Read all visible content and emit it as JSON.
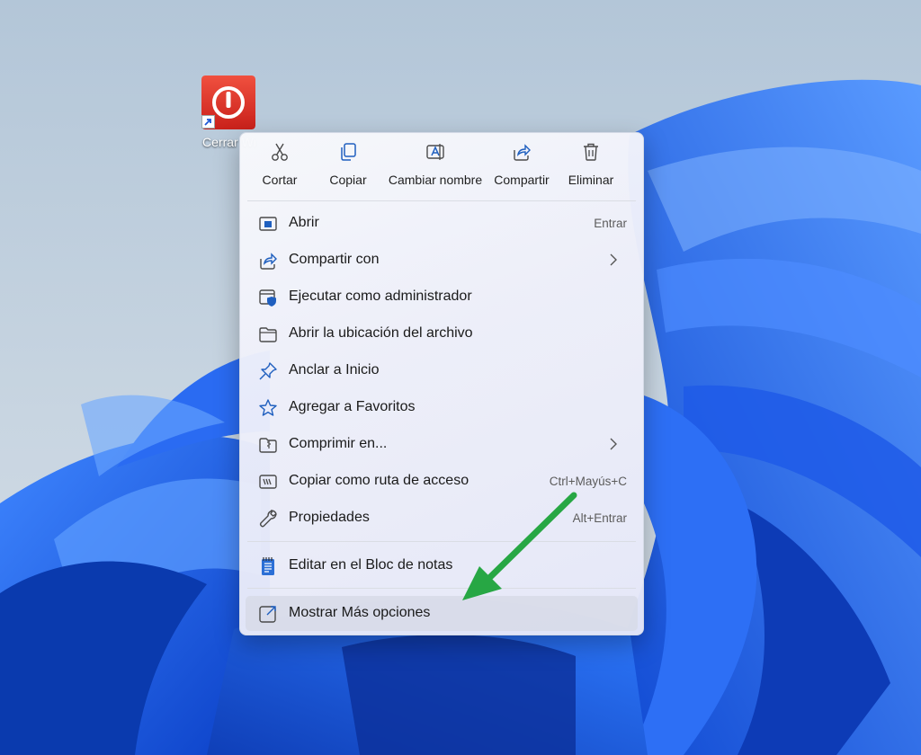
{
  "colors": {
    "accent": "#0067c0",
    "arrow": "#27a744",
    "wallpaper_blue": "#1e5fe6",
    "icon_red": "#e0312a"
  },
  "desktop_icon": {
    "label": "Cerrar Wi",
    "icon": "power-icon"
  },
  "context_menu": {
    "quick_actions": [
      {
        "label": "Cortar",
        "icon": "scissors-icon"
      },
      {
        "label": "Copiar",
        "icon": "copy-icon"
      },
      {
        "label": "Cambiar nombre",
        "icon": "rename-icon"
      },
      {
        "label": "Compartir",
        "icon": "share-icon"
      },
      {
        "label": "Eliminar",
        "icon": "trash-icon"
      }
    ],
    "items": [
      {
        "label": "Abrir",
        "shortcut": "Entrar",
        "icon": "open-app-icon"
      },
      {
        "label": "Compartir con",
        "submenu": true,
        "icon": "share-with-icon"
      },
      {
        "label": "Ejecutar como administrador",
        "icon": "admin-shield-icon"
      },
      {
        "label": "Abrir la ubicación del archivo",
        "icon": "folder-icon"
      },
      {
        "label": "Anclar a Inicio",
        "icon": "pin-icon"
      },
      {
        "label": "Agregar a Favoritos",
        "icon": "star-icon"
      },
      {
        "label": "Comprimir en...",
        "submenu": true,
        "icon": "zip-folder-icon"
      },
      {
        "label": "Copiar como ruta de acceso",
        "shortcut": "Ctrl+Mayús+C",
        "icon": "copy-path-icon"
      },
      {
        "label": "Propiedades",
        "shortcut": "Alt+Entrar",
        "icon": "wrench-icon"
      },
      {
        "label": "Editar en el Bloc de notas",
        "icon": "notepad-icon"
      },
      {
        "label": "Mostrar Más opciones",
        "icon": "more-options-icon",
        "highlighted": true
      }
    ]
  }
}
